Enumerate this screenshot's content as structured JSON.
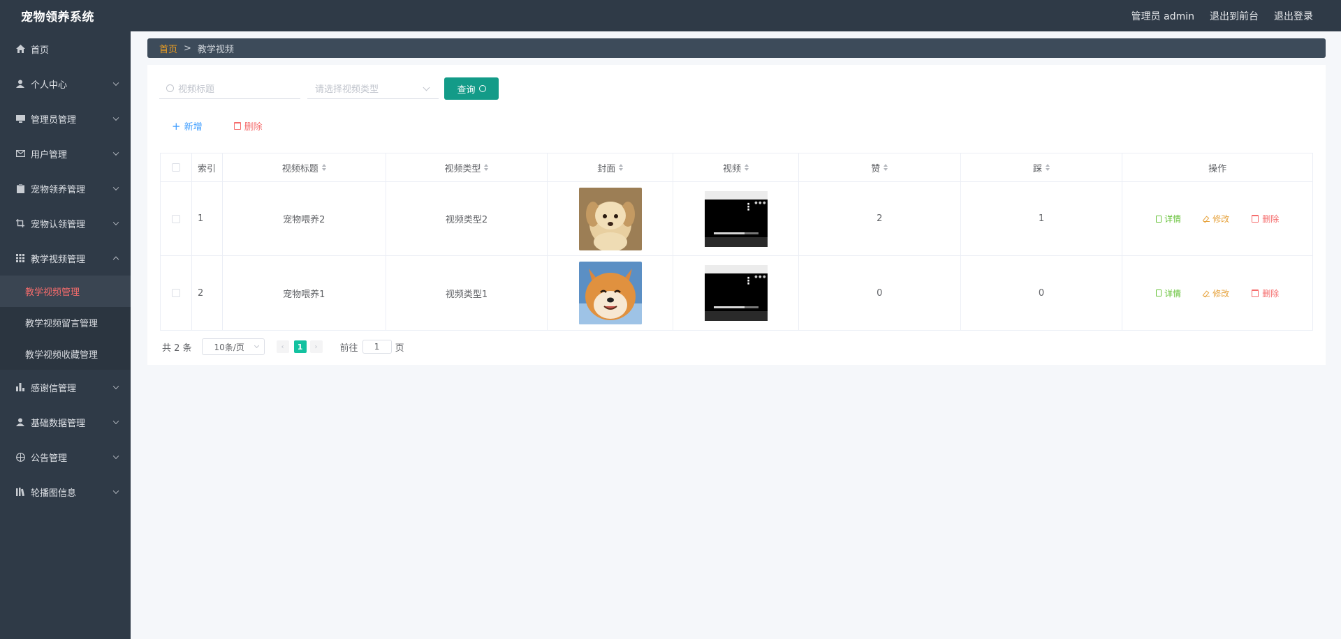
{
  "app": {
    "title": "宠物领养系统"
  },
  "header": {
    "admin_label": "管理员 admin",
    "to_front": "退出到前台",
    "logout": "退出登录"
  },
  "sidebar": {
    "items": [
      {
        "label": "首页",
        "icon": "home-icon"
      },
      {
        "label": "个人中心",
        "icon": "user-icon"
      },
      {
        "label": "管理员管理",
        "icon": "monitor-icon"
      },
      {
        "label": "用户管理",
        "icon": "mail-icon"
      },
      {
        "label": "宠物领养管理",
        "icon": "clipboard-icon"
      },
      {
        "label": "宠物认领管理",
        "icon": "crop-icon"
      },
      {
        "label": "教学视频管理",
        "icon": "grid-icon"
      },
      {
        "label": "感谢信管理",
        "icon": "bar-chart-icon"
      },
      {
        "label": "基础数据管理",
        "icon": "user-icon"
      },
      {
        "label": "公告管理",
        "icon": "compass-icon"
      },
      {
        "label": "轮播图信息",
        "icon": "library-icon"
      }
    ],
    "sub_items": [
      "教学视频管理",
      "教学视频留言管理",
      "教学视频收藏管理"
    ]
  },
  "breadcrumb": {
    "home": "首页",
    "sep": ">",
    "current": "教学视频"
  },
  "search": {
    "title_placeholder": "视频标题",
    "type_placeholder": "请选择视频类型",
    "query_label": "查询"
  },
  "actions": {
    "add": "新增",
    "delete": "删除"
  },
  "table": {
    "headers": [
      "索引",
      "视频标题",
      "视频类型",
      "封面",
      "视频",
      "赞",
      "踩",
      "操作"
    ],
    "rows": [
      {
        "index": "1",
        "title": "宠物喂养2",
        "type": "视频类型2",
        "likes": "2",
        "dislikes": "1"
      },
      {
        "index": "2",
        "title": "宠物喂养1",
        "type": "视频类型1",
        "likes": "0",
        "dislikes": "0"
      }
    ],
    "ops": {
      "detail": "详情",
      "edit": "修改",
      "delete": "删除"
    }
  },
  "pagination": {
    "total": "共 2 条",
    "page_size": "10条/页",
    "current_page": "1",
    "goto_label": "前往",
    "goto_value": "1",
    "page_unit": "页"
  },
  "colors": {
    "sidebar_bg": "#2f3a47",
    "accent": "#139b88",
    "active_menu": "#f56c6c"
  }
}
